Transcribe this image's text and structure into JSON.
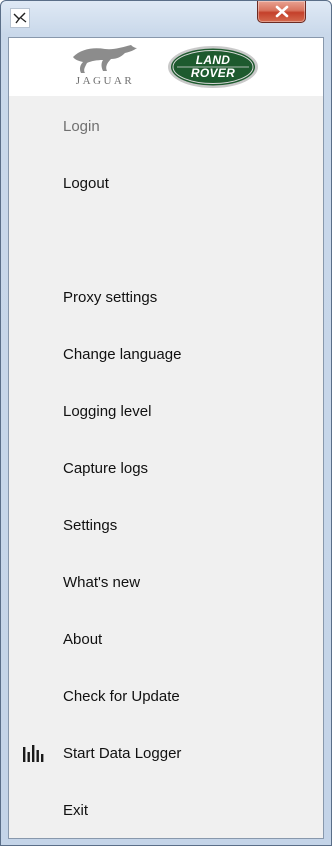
{
  "window": {
    "close_icon": "close-icon",
    "app_icon": "app-logo-icon"
  },
  "logos": {
    "jaguar_word": "JAGUAR",
    "landrover_line1": "LAND",
    "landrover_line2": "ROVER",
    "landrover_color": "#1d5a2e"
  },
  "menu": {
    "items": [
      {
        "label": "Login",
        "enabled": false
      },
      {
        "label": "Logout",
        "enabled": true
      },
      {
        "label": "Proxy settings",
        "enabled": true
      },
      {
        "label": "Change language",
        "enabled": true
      },
      {
        "label": "Logging level",
        "enabled": true
      },
      {
        "label": "Capture logs",
        "enabled": true
      },
      {
        "label": "Settings",
        "enabled": true
      },
      {
        "label": "What's new",
        "enabled": true
      },
      {
        "label": "About",
        "enabled": true
      },
      {
        "label": "Check for Update",
        "enabled": true
      },
      {
        "label": "Start Data Logger",
        "enabled": true,
        "icon": "bar-chart-icon"
      },
      {
        "label": "Exit",
        "enabled": true
      }
    ]
  }
}
